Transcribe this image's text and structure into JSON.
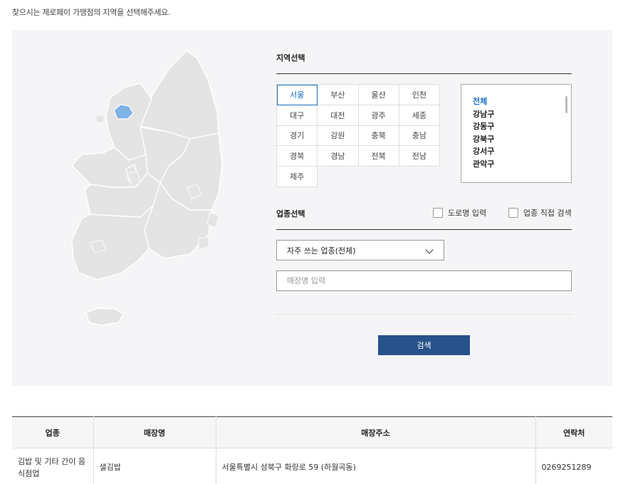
{
  "intro_text": "찾으시는 제로페이 가맹점의 지역을 선택해주세요.",
  "region_section": {
    "title": "지역선택",
    "regions": [
      {
        "label": "서울",
        "active": true
      },
      {
        "label": "부산"
      },
      {
        "label": "울산"
      },
      {
        "label": "인천"
      },
      {
        "label": "대구"
      },
      {
        "label": "대전"
      },
      {
        "label": "광주"
      },
      {
        "label": "세종"
      },
      {
        "label": "경기"
      },
      {
        "label": "강원"
      },
      {
        "label": "충북"
      },
      {
        "label": "충남"
      },
      {
        "label": "경북"
      },
      {
        "label": "경남"
      },
      {
        "label": "전북"
      },
      {
        "label": "전남"
      },
      {
        "label": "제주"
      }
    ],
    "districts": [
      {
        "label": "전체",
        "active": true
      },
      {
        "label": "강남구"
      },
      {
        "label": "강동구"
      },
      {
        "label": "강북구"
      },
      {
        "label": "강서구"
      },
      {
        "label": "관악구"
      }
    ]
  },
  "category_section": {
    "title": "업종선택",
    "road_name_label": "도로명 입력",
    "direct_category_label": "업종 직접 검색",
    "select_value": "자주 쓰는 업종(전체)",
    "store_name_placeholder": "매장명 입력",
    "search_label": "검색"
  },
  "results": {
    "headers": [
      "업종",
      "매장명",
      "매장주소",
      "연락처"
    ],
    "rows": [
      [
        "김밥 및 기타 간이 음식점업",
        "샐김밥",
        "서울특별시 성북구 화랑로 59 (하월곡동)",
        "0269251289"
      ]
    ]
  },
  "colors": {
    "accent": "#1a6fc0",
    "button": "#27528a",
    "map_fill": "#e4e4e4",
    "map_highlight": "#7fb3e6"
  }
}
